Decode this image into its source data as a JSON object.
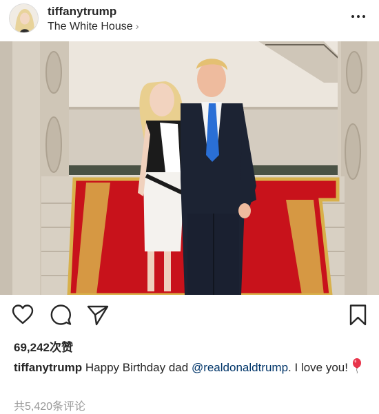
{
  "post": {
    "username": "tiffanytrump",
    "location": "The White House",
    "location_chevron": "›",
    "more_icon": "more-horizontal-icon",
    "likes": "69,242次赞",
    "caption": {
      "username": "tiffanytrump",
      "text_before": " Happy Birthday dad ",
      "mention": "@realdonaldtrump",
      "text_after": ". I love you!",
      "emoji": "balloon-icon"
    },
    "comments_label": "共5,420条评论"
  },
  "actions": {
    "like_icon": "heart-icon",
    "comment_icon": "comment-icon",
    "share_icon": "send-icon",
    "save_icon": "bookmark-icon"
  },
  "colors": {
    "text": "#262626",
    "secondary": "#999999",
    "mention": "#003569",
    "balloon": "#e8354b",
    "carpet": "#c8121b",
    "carpet_border": "#d8b04a"
  }
}
